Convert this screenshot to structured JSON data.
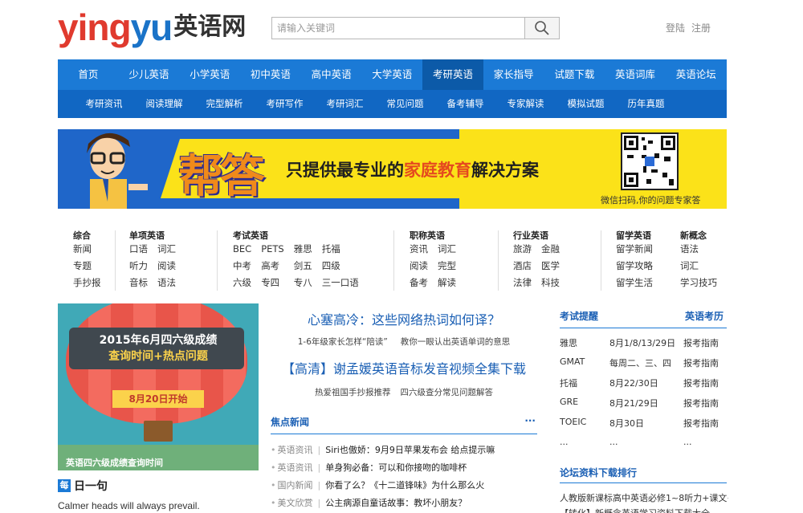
{
  "logo": {
    "en1": "ying",
    "en2": "yu",
    "cn": "英语网"
  },
  "search": {
    "placeholder": "请输入关键词"
  },
  "toplinks": {
    "login": "登陆",
    "register": "注册"
  },
  "nav_main": [
    "首页",
    "少儿英语",
    "小学英语",
    "初中英语",
    "高中英语",
    "大学英语",
    "考研英语",
    "家长指导",
    "试题下载",
    "英语词库",
    "英语论坛"
  ],
  "nav_main_active": "考研英语",
  "nav_sub": [
    "考研资讯",
    "阅读理解",
    "完型解析",
    "考研写作",
    "考研词汇",
    "常见问题",
    "备考辅导",
    "专家解读",
    "模拟试题",
    "历年真题"
  ],
  "banner": {
    "big": "帮答",
    "slogan_pre": "只提供最专业的",
    "slogan_hl": "家庭教育",
    "slogan_post": "解决方案",
    "qr_caption": "微信扫码,你的问题专家答"
  },
  "categories": [
    {
      "title": "综合",
      "items": [
        "新闻",
        "专题",
        "手抄报"
      ]
    },
    {
      "title": "单项英语",
      "items": [
        "口语",
        "词汇",
        "听力",
        "阅读",
        "音标",
        "语法"
      ]
    },
    {
      "title": "考试英语",
      "items": [
        "BEC",
        "PETS",
        "雅思",
        "托福",
        "中考",
        "高考",
        "剑五",
        "四级",
        "六级",
        "专四",
        "专八",
        "三一口语"
      ]
    },
    {
      "title": "职称英语",
      "items": [
        "资讯",
        "词汇",
        "阅读",
        "完型",
        "备考",
        "解读"
      ]
    },
    {
      "title": "行业英语",
      "items": [
        "旅游",
        "金融",
        "酒店",
        "医学",
        "法律",
        "科技"
      ]
    },
    {
      "title": "留学英语",
      "items": [
        "留学新闻",
        "留学攻略",
        "留学生活"
      ]
    },
    {
      "title": "新概念",
      "items": [
        "语法",
        "词汇",
        "学习技巧"
      ]
    }
  ],
  "card": {
    "line1": "2015年6月四六级成绩",
    "line2": "查询时间+热点问题",
    "ribbon": "8月20日开始",
    "caption": "英语四六级成绩查询时间"
  },
  "daily": {
    "icon": "每",
    "title": "日一句",
    "quote": "Calmer heads will always prevail."
  },
  "middle": {
    "headline1": "心塞高冷：这些网络热词如何译？",
    "sub1": [
      "1-6年级家长怎样“陪读”",
      "教你一眼认出英语单词的意思"
    ],
    "headline2": "【高清】谢孟媛英语音标发音视频全集下载",
    "sub2": [
      "热爱祖国手抄报推荐",
      "四六级查分常见问题解答"
    ],
    "news_title": "焦点新闻",
    "news_more": "···",
    "news": [
      {
        "tag": "英语资讯",
        "title": "Siri也傲娇：9月9日苹果发布会 给点提示嘛"
      },
      {
        "tag": "英语资讯",
        "title": "单身狗必备：可以和你接吻的咖啡杯"
      },
      {
        "tag": "国内新闻",
        "title": "你看了么？《十二道锋味》为什么那么火"
      },
      {
        "tag": "美文欣赏",
        "title": "公主病源自童话故事：教坏小朋友？"
      }
    ]
  },
  "right": {
    "head_left": "考试提醒",
    "head_right": "英语考历",
    "exams": [
      {
        "name": "雅思",
        "date": "8月1/8/13/29日",
        "link": "报考指南"
      },
      {
        "name": "GMAT",
        "date": "每周二、三、四",
        "link": "报考指南"
      },
      {
        "name": "托福",
        "date": "8月22/30日",
        "link": "报考指南"
      },
      {
        "name": "GRE",
        "date": "8月21/29日",
        "link": "报考指南"
      },
      {
        "name": "TOEIC",
        "date": "8月30日",
        "link": "报考指南"
      },
      {
        "name": "...",
        "date": "...",
        "link": "..."
      }
    ],
    "forum_title": "论坛资料下载排行",
    "forum_item1": "人教版新课标高中英语必修1~8听力+课文+单",
    "forum_item2": "【转化】新概念英语学习资料下载大全"
  }
}
